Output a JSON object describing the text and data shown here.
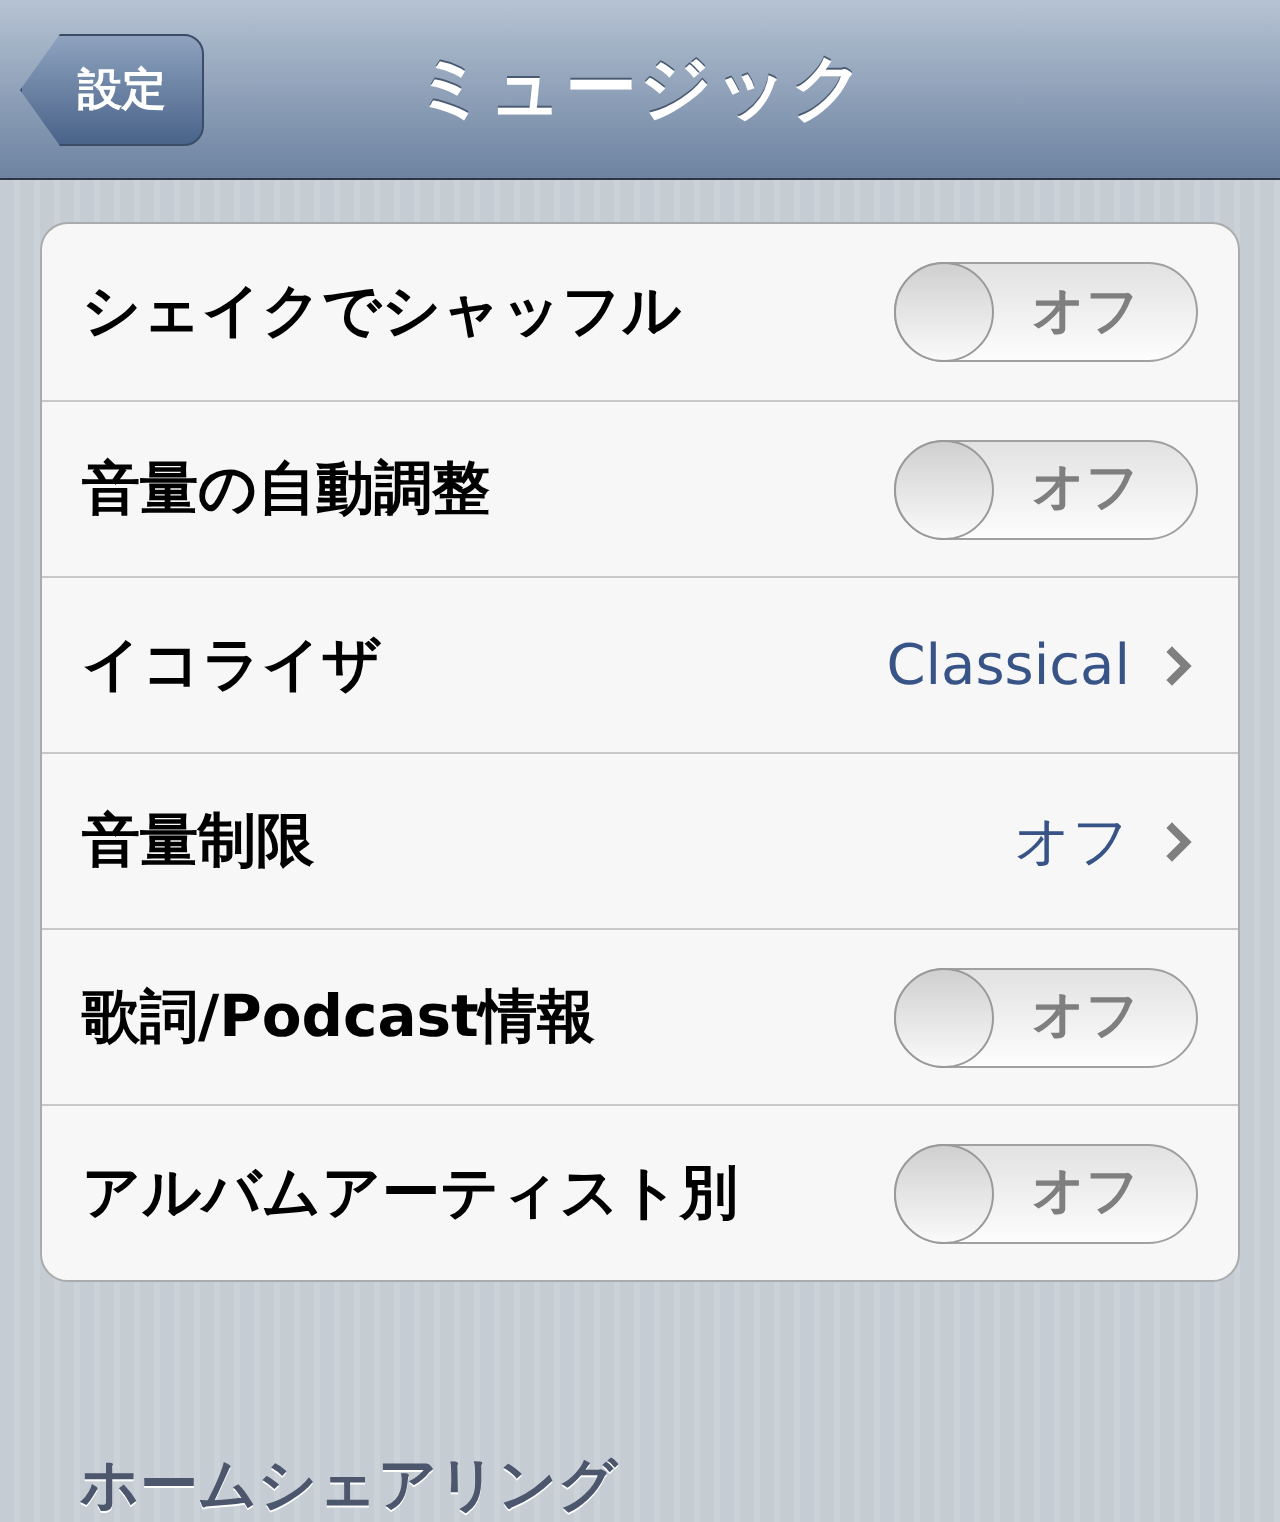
{
  "nav_bar": {
    "back_button": "設定",
    "title": "ミュージック"
  },
  "settings": [
    {
      "kind": "toggle",
      "label": "シェイクでシャッフル",
      "on": false,
      "state_text": "オフ"
    },
    {
      "kind": "toggle",
      "label": "音量の自動調整",
      "on": false,
      "state_text": "オフ"
    },
    {
      "kind": "disclosure",
      "label": "イコライザ",
      "value": "Classical"
    },
    {
      "kind": "disclosure",
      "label": "音量制限",
      "value": "オフ"
    },
    {
      "kind": "toggle",
      "label": "歌詞/Podcast情報",
      "on": false,
      "state_text": "オフ"
    },
    {
      "kind": "toggle",
      "label": "アルバムアーティスト別",
      "on": false,
      "state_text": "オフ"
    }
  ],
  "section_header": "ホームシェアリング"
}
